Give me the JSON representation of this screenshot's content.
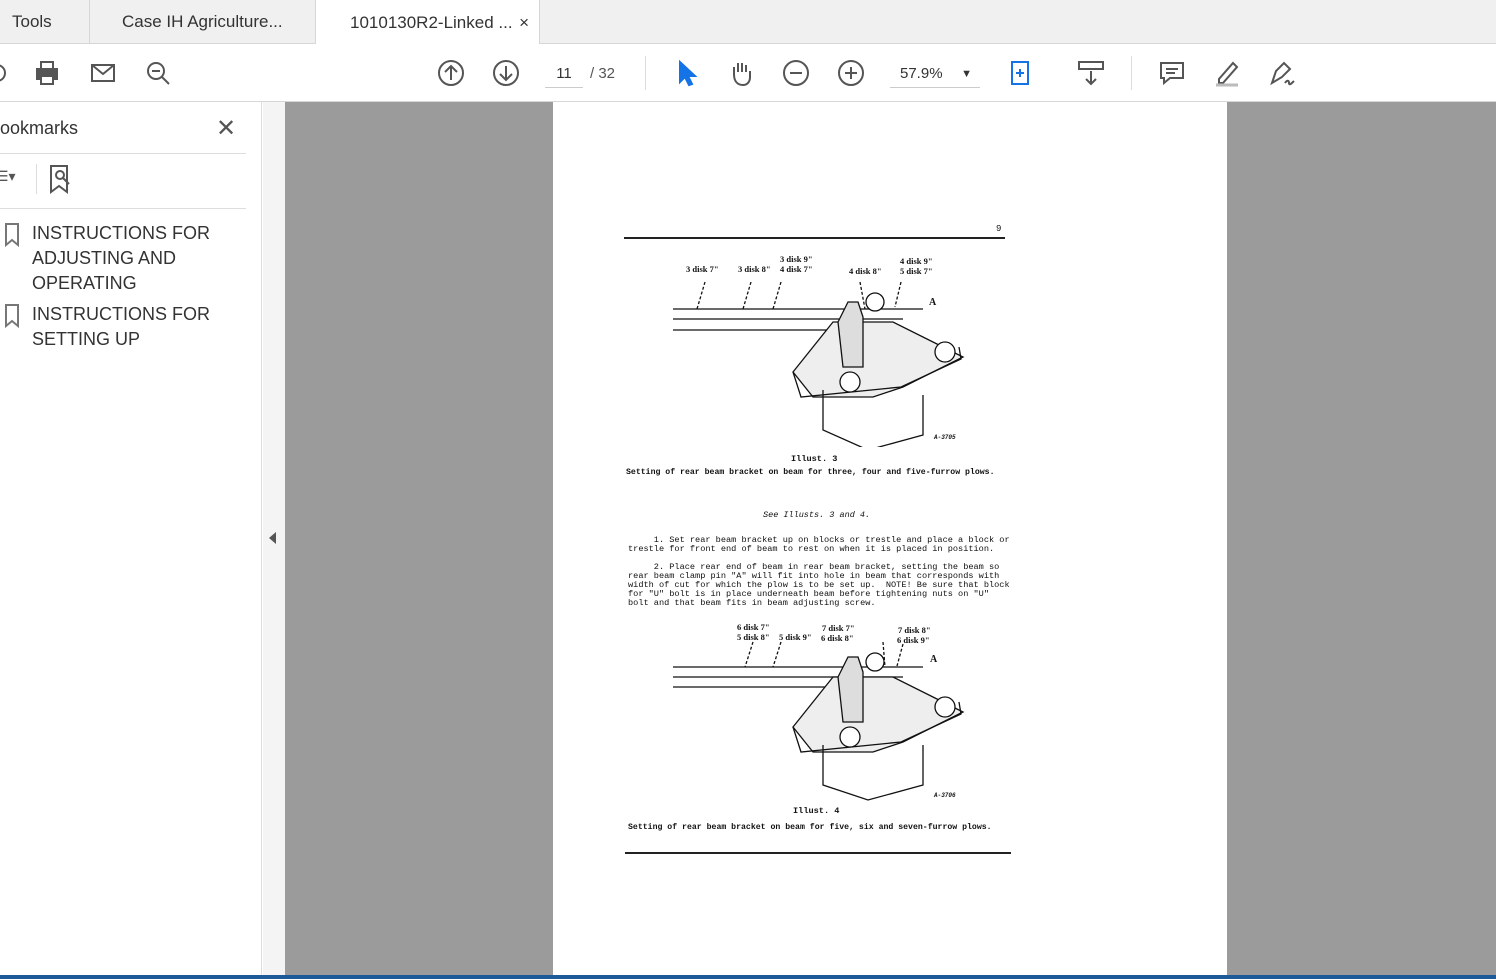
{
  "tabs": [
    {
      "label": "Tools"
    },
    {
      "label": "Case IH Agriculture..."
    },
    {
      "label": "1010130R2-Linked ...",
      "close": "×"
    }
  ],
  "toolbar": {
    "page_current": "11",
    "page_total": "/ 32",
    "zoom": "57.9%"
  },
  "sidebar": {
    "title": "ookmarks",
    "close": "✕",
    "items": [
      {
        "label": "INSTRUCTIONS FOR ADJUSTING AND OPERATING"
      },
      {
        "label": "INSTRUCTIONS FOR SETTING UP"
      }
    ]
  },
  "page": {
    "number": "9",
    "fig3": {
      "labels": [
        "3 disk 7\"",
        "3 disk 8\"",
        "3 disk 9\"",
        "4 disk 7\"",
        "4 disk 8\"",
        "4 disk 9\"",
        "5 disk 7\""
      ],
      "pin": "A",
      "code": "A-3705",
      "title": "Illust. 3",
      "caption": "Setting of rear beam bracket on beam for three, four and five-furrow plows."
    },
    "see": "See Illusts. 3 and 4.",
    "para1": "     1. Set rear beam bracket up on blocks or trestle and place a block or\ntrestle for front end of beam to rest on when it is placed in position.",
    "para2": "     2. Place rear end of beam in rear beam bracket, setting the beam so\nrear beam clamp pin \"A\" will fit into hole in beam that corresponds with\nwidth of cut for which the plow is to be set up.  NOTE! Be sure that block\nfor \"U\" bolt is in place underneath beam before tightening nuts on \"U\"\nbolt and that beam fits in beam adjusting screw.",
    "fig4": {
      "labels": [
        "6 disk 7\"",
        "5 disk 8\"",
        "5 disk 9\"",
        "7 disk 7\"",
        "6 disk 8\"",
        "7 disk 8\"",
        "6 disk 9\""
      ],
      "pin": "A",
      "code": "A-3706",
      "title": "Illust. 4",
      "caption": "Setting of rear beam bracket on beam for five, six and seven-furrow plows."
    }
  }
}
